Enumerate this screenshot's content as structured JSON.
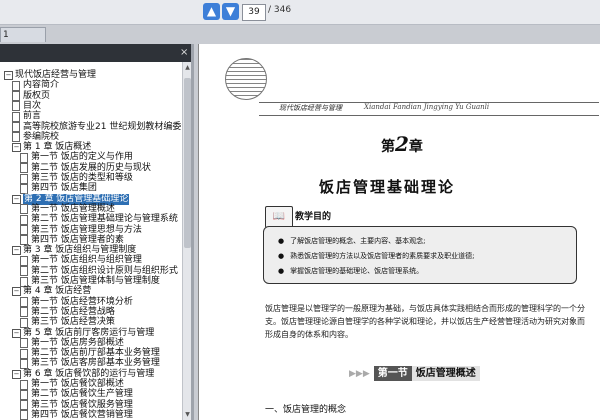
{
  "toolbar": {
    "up_arrow": "▲",
    "down_arrow": "▼",
    "page_current": "39",
    "page_total": "/ 346"
  },
  "panel": {
    "tab_label": "1",
    "close_icon": "×"
  },
  "tree": [
    {
      "level": 0,
      "toggle": "−",
      "label": "现代饭店经营与管理"
    },
    {
      "level": 1,
      "toggle": "",
      "label": "内容简介"
    },
    {
      "level": 1,
      "toggle": "",
      "label": "版权页"
    },
    {
      "level": 1,
      "toggle": "",
      "label": "目次"
    },
    {
      "level": 1,
      "toggle": "",
      "label": "前言"
    },
    {
      "level": 1,
      "toggle": "",
      "label": "高等院校旅游专业21 世纪规划教材编委会"
    },
    {
      "level": 1,
      "toggle": "",
      "label": "参编院校"
    },
    {
      "level": 1,
      "toggle": "−",
      "label": "第 1 章  饭店概述"
    },
    {
      "level": 2,
      "toggle": "",
      "label": "第一节  饭店的定义与作用"
    },
    {
      "level": 2,
      "toggle": "",
      "label": "第二节  饭店发展的历史与现状"
    },
    {
      "level": 2,
      "toggle": "",
      "label": "第三节  饭店的类型和等级"
    },
    {
      "level": 2,
      "toggle": "",
      "label": "第四节  饭店集团"
    },
    {
      "level": 1,
      "toggle": "−",
      "label": "第 2 章  饭店管理基础理论",
      "selected": true
    },
    {
      "level": 2,
      "toggle": "",
      "label": "第一节  饭店管理概述"
    },
    {
      "level": 2,
      "toggle": "",
      "label": "第二节  饭店管理基础理论与管理系统"
    },
    {
      "level": 2,
      "toggle": "",
      "label": "第三节  饭店管理思想与方法"
    },
    {
      "level": 2,
      "toggle": "",
      "label": "第四节  饭店管理者的素"
    },
    {
      "level": 1,
      "toggle": "−",
      "label": "第 3 章  饭店组织与管理制度"
    },
    {
      "level": 2,
      "toggle": "",
      "label": "第一节  饭店组织与组织管理"
    },
    {
      "level": 2,
      "toggle": "",
      "label": "第二节  饭店组织设计原则与组织形式"
    },
    {
      "level": 2,
      "toggle": "",
      "label": "第三节  饭店管理体制与管理制度"
    },
    {
      "level": 1,
      "toggle": "−",
      "label": "第 4 章  饭店经营"
    },
    {
      "level": 2,
      "toggle": "",
      "label": "第一节  饭店经营环境分析"
    },
    {
      "level": 2,
      "toggle": "",
      "label": "第二节  饭店经营战略"
    },
    {
      "level": 2,
      "toggle": "",
      "label": "第三节  饭店经营决策"
    },
    {
      "level": 1,
      "toggle": "−",
      "label": "第 5 章  饭店前厅客房运行与管理"
    },
    {
      "level": 2,
      "toggle": "",
      "label": "第一节  饭店房务部概述"
    },
    {
      "level": 2,
      "toggle": "",
      "label": "第二节  饭店前厅部基本业务管理"
    },
    {
      "level": 2,
      "toggle": "",
      "label": "第三节  饭店客房部基本业务管理"
    },
    {
      "level": 1,
      "toggle": "−",
      "label": "第 6 章  饭店餐饮部的运行与管理"
    },
    {
      "level": 2,
      "toggle": "",
      "label": "第一节  饭店餐饮部概述"
    },
    {
      "level": 2,
      "toggle": "",
      "label": "第二节  饭店餐饮生产管理"
    },
    {
      "level": 2,
      "toggle": "",
      "label": "第三节  饭店餐饮服务管理"
    },
    {
      "level": 2,
      "toggle": "",
      "label": "第四节  饭店餐饮营销管理"
    }
  ],
  "page": {
    "header_cn": "现代饭店经营与管理",
    "header_pinyin": "Xiandai Fandian Jingying Yu Guanli",
    "chapter_prefix": "第",
    "chapter_num": "2",
    "chapter_suffix": "章",
    "chapter_title": "饭店管理基础理论",
    "goals_label": "教学目的",
    "goals": [
      "了解饭店管理的概念、主要内容、基本观念;",
      "熟悉饭店管理的方法以及饭店管理者的素质要求及职业道德;",
      "掌握饭店管理的基础理论、饭店管理系统。"
    ],
    "intro": "饭店管理是以管理学的一般原理为基础，与饭店具体实践相结合而形成的管理科学的一个分支。饭店管理理论源自管理学的各种学说和理论，并以饭店生产经营管理活动为研究对象而形成自身的体系和内容。",
    "section_num": "第一节",
    "section_title": "饭店管理概述",
    "subhead": "一、饭店管理的概念"
  }
}
